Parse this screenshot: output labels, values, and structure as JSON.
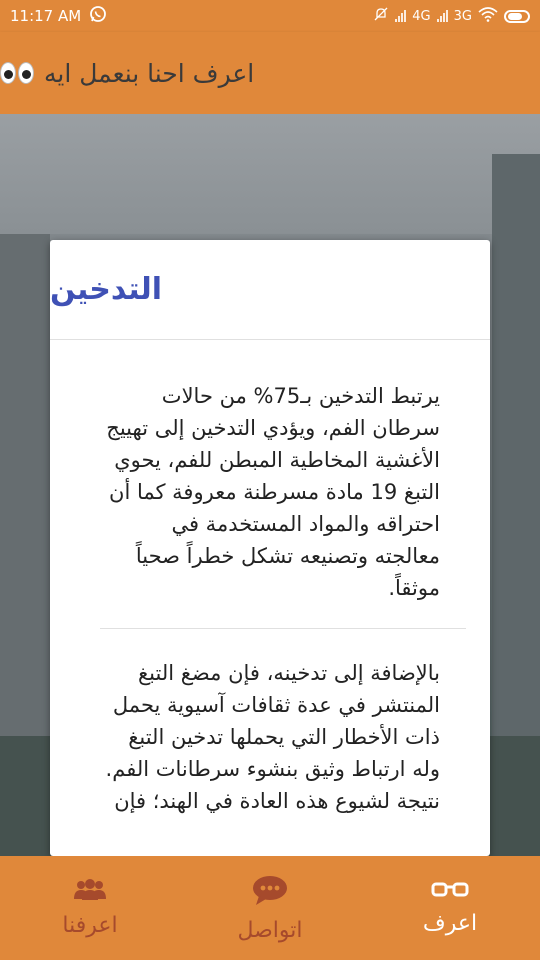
{
  "status_bar": {
    "time": "11:17 AM",
    "network_1": "4G",
    "network_2": "3G",
    "icons": [
      "whatsapp-icon",
      "mute-icon",
      "signal-icon",
      "wifi-icon",
      "battery-icon"
    ]
  },
  "app_bar": {
    "title": "اعرف احنا بنعمل ايه",
    "title_icon": "eyes-emoji-icon",
    "background_color": "#e0883a"
  },
  "card": {
    "title": "التدخين",
    "paragraphs": [
      "يرتبط التدخين بـ75% من حالات سرطان الفم، ويؤدي التدخين إلى تهييج الأغشية المخاطية المبطن للفم، يحوي التبغ 19 مادة مسرطنة معروفة كما أن احتراقه والمواد المستخدمة في معالجته وتصنيعه تشكل خطراً صحياً موثقاً.",
      "بالإضافة إلى تدخينه، فإن مضغ التبغ المنتشر في عدة ثقافات آسيوية يحمل ذات الأخطار التي يحملها تدخين التبغ وله ارتباط وثيق بنشوء سرطانات الفم. نتيجة لشيوع هذه العادة في الهند؛ فإن"
    ],
    "title_color": "#3f51b5"
  },
  "bottom_nav": {
    "items": [
      {
        "label": "اعرف",
        "icon": "glasses-icon",
        "active": true
      },
      {
        "label": "اتواصل",
        "icon": "chat-bubble-icon",
        "active": false
      },
      {
        "label": "اعرفنا",
        "icon": "people-icon",
        "active": false
      }
    ],
    "inactive_color": "#a64a2c",
    "active_color": "#ffffff"
  }
}
